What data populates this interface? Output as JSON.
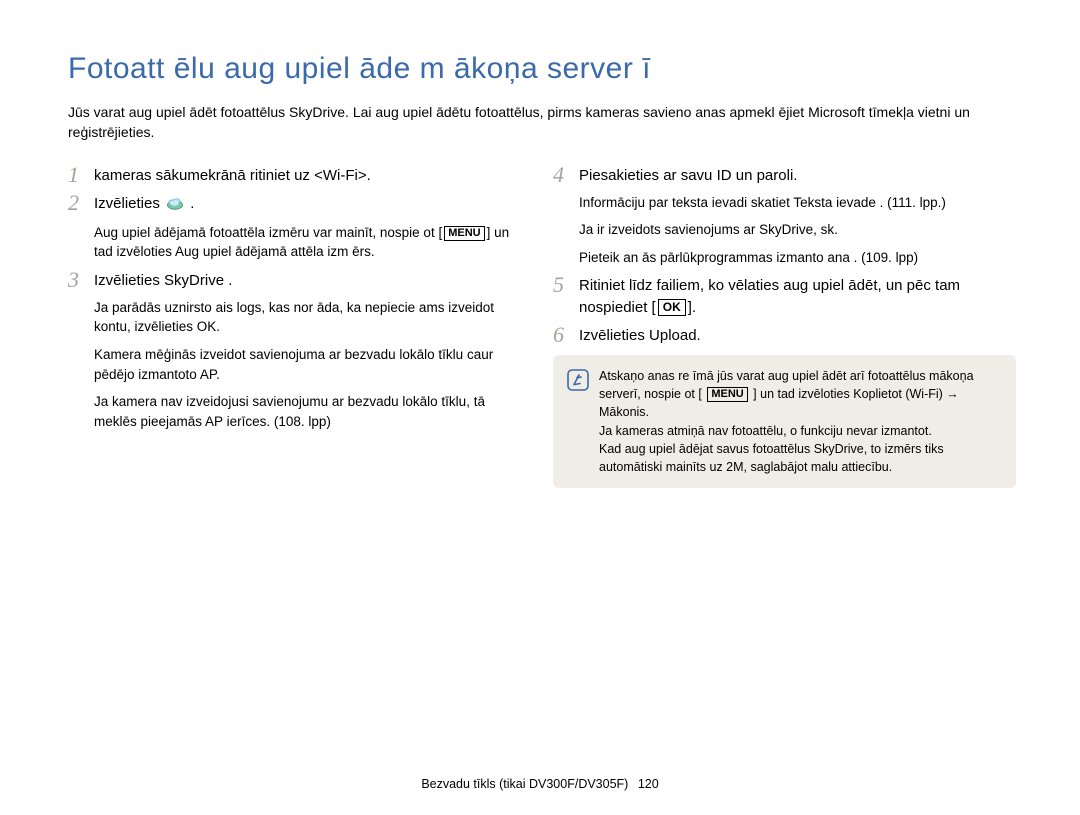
{
  "title": "Fotoatt ēlu aug upiel āde m ākoņa server ī",
  "intro": "Jūs varat aug upiel ādēt fotoattēlus SkyDrive. Lai aug upiel ādētu fotoattēlus, pirms kameras savieno anas apmekl ējiet Microsoft tīmekļa vietni un reģistrējieties.",
  "left": {
    "s1": {
      "num": "1",
      "text": "kameras sākumekrānā ritiniet uz <Wi-Fi>."
    },
    "s2": {
      "num": "2",
      "text_a": "Izvēlieties ",
      "text_b": " .",
      "sub_a": "Aug upiel ādējamā fotoattēla izmēru var mainīt, nospie ot [",
      "sub_b": "] un tad izvēloties Aug upiel ādējamā attēla izm ērs."
    },
    "s3": {
      "num": "3",
      "text": "Izvēlieties SkyDrive .",
      "sub1": "Ja parādās uznirsto ais logs, kas nor āda, ka nepiecie ams izveidot kontu, izvēlieties OK.",
      "sub2": "Kamera mēģinās izveidot savienojuma ar bezvadu lokālo tīklu caur pēdējo izmantoto AP.",
      "sub3": "Ja kamera nav izveidojusi savienojumu ar bezvadu lokālo tīklu, tā meklēs pieejamās AP ierīces. (108. lpp)"
    }
  },
  "right": {
    "s4": {
      "num": "4",
      "text": "Piesakieties ar savu ID un paroli.",
      "sub1": "Informāciju par teksta ievadi skatiet Teksta ievade . (111. lpp.)",
      "sub2": "Ja ir izveidots savienojums ar SkyDrive, sk.",
      "sub3": "Pieteik an ās pārlūkprogrammas izmanto ana . (109. lpp)"
    },
    "s5": {
      "num": "5",
      "text_a": "Ritiniet līdz failiem, ko vēlaties aug upiel ādēt, un pēc tam nospiediet [",
      "text_b": "]."
    },
    "s6": {
      "num": "6",
      "text": "Izvēlieties Upload."
    }
  },
  "note": {
    "l1a": "Atskaņo anas re īmā jūs varat aug upiel ādēt arī fotoattēlus mākoņa serverī, nospie ot [ ",
    "l1b": " ] un tad izvēloties Koplietot (Wi-Fi)   → Mākonis.",
    "l2": "Ja kameras atmiņā nav fotoattēlu, o funkciju nevar izmantot.",
    "l3": "Kad aug upiel ādējat savus fotoattēlus SkyDrive, to izmērs tiks automātiski mainīts uz 2M, saglabājot malu attiecību."
  },
  "footer": {
    "text": "Bezvadu tīkls (tikai DV300F/DV305F)",
    "page": "120"
  }
}
